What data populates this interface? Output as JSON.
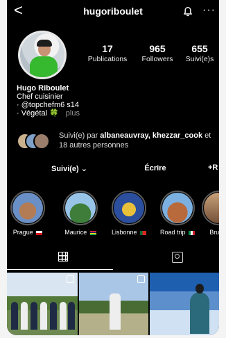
{
  "header": {
    "username": "hugoriboulet",
    "back_glyph": "<",
    "more_glyph": "···"
  },
  "stats": [
    {
      "value": "17",
      "label": "Publications"
    },
    {
      "value": "965",
      "label": "Followers"
    },
    {
      "value": "655",
      "label": "Suivi(e)s"
    }
  ],
  "bio": {
    "name": "Hugo Riboulet",
    "line1": "Chef cuisinier",
    "line2": "· @topchefm6 s14",
    "line3": "· Végétal 🍀",
    "more": "plus"
  },
  "followed_by": {
    "prefix": "Suivi(e) par ",
    "users": "albaneauvray, khezzar_cook",
    "suffix": " et 18 autres personnes"
  },
  "actions": {
    "follow": "Suivi(e) ⌄",
    "message": "Écrire",
    "add_user": "+R"
  },
  "highlights": [
    {
      "label": "Prague",
      "icon": "flag-cz"
    },
    {
      "label": "Maurice",
      "icon": "flag-mu"
    },
    {
      "label": "Lisbonne",
      "icon": "flag-pt"
    },
    {
      "label": "Road trip",
      "icon": "flag-it"
    },
    {
      "label": "Bruxell",
      "icon": ""
    }
  ],
  "icons": [
    "back-icon",
    "bell-icon",
    "more-icon",
    "grid-icon",
    "tagged-icon",
    "add-user-icon"
  ],
  "colors": {
    "background": "#000000",
    "text": "#ffffff",
    "secondary_text": "#9a9a9a",
    "accent_green": "#36b82f"
  }
}
